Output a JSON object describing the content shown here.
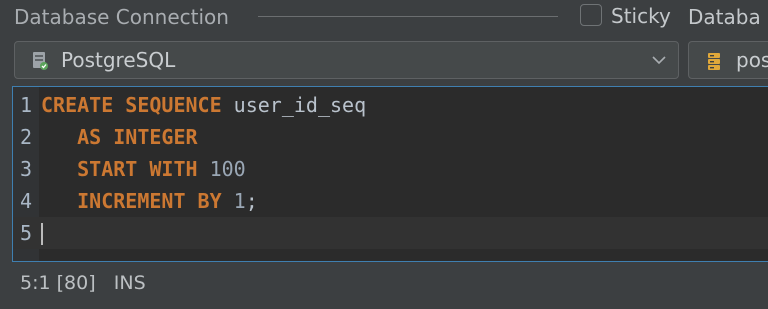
{
  "header": {
    "section_title": "Database Connection",
    "sticky_label": "Sticky",
    "sticky_checked": false,
    "database_label": "Databa"
  },
  "driver_select": {
    "value": "PostgreSQL",
    "icon": "postgresql-driver-icon"
  },
  "connection_select": {
    "value": "pos",
    "icon": "database-connection-icon"
  },
  "editor": {
    "lines": [
      {
        "number": "1",
        "tokens": [
          {
            "text": "CREATE SEQUENCE",
            "type": "keyword"
          },
          {
            "text": " user_id_seq",
            "type": "identifier"
          }
        ]
      },
      {
        "number": "2",
        "tokens": [
          {
            "text": "   ",
            "type": "space"
          },
          {
            "text": "AS INTEGER",
            "type": "keyword"
          }
        ]
      },
      {
        "number": "3",
        "tokens": [
          {
            "text": "   ",
            "type": "space"
          },
          {
            "text": "START WITH",
            "type": "keyword"
          },
          {
            "text": " 100",
            "type": "number"
          }
        ]
      },
      {
        "number": "4",
        "tokens": [
          {
            "text": "   ",
            "type": "space"
          },
          {
            "text": "INCREMENT BY",
            "type": "keyword"
          },
          {
            "text": " 1",
            "type": "number"
          },
          {
            "text": ";",
            "type": "punct"
          }
        ]
      },
      {
        "number": "5",
        "tokens": []
      }
    ],
    "keyword_color": "#cc7832"
  },
  "status": {
    "position": "5:1 [80]",
    "mode": "INS"
  }
}
